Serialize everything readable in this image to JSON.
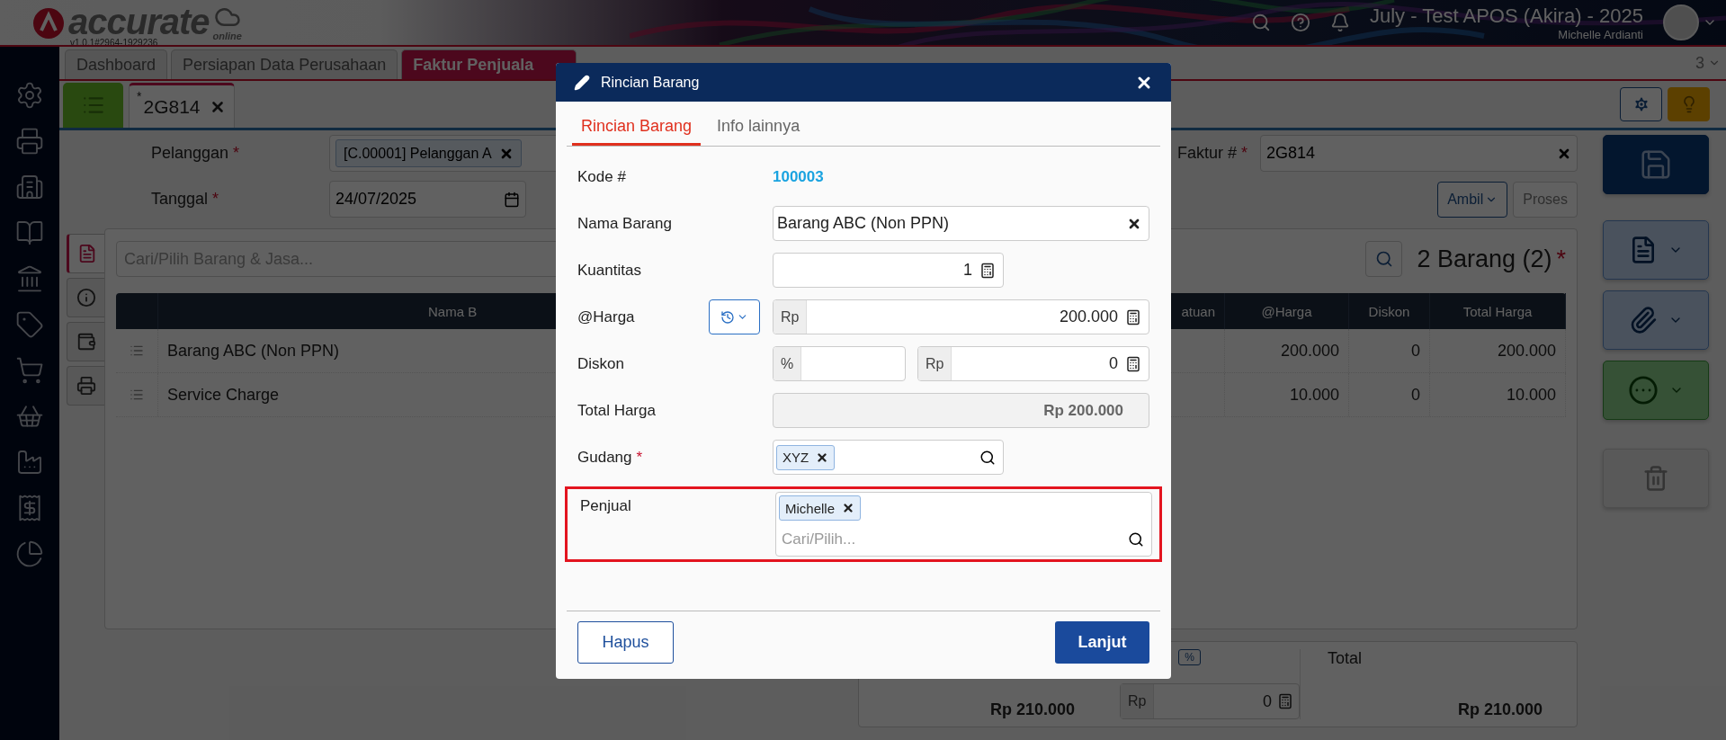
{
  "header": {
    "logo": "accurate",
    "logo_sub": "online",
    "version": "v1.0.1#2964-1929236",
    "company": "July - Test APOS (Akira) - 2025",
    "user": "Michelle Ardianti"
  },
  "page_tabs": [
    {
      "label": "Dashboard",
      "selected": false
    },
    {
      "label": "Persiapan Data Perusahaan",
      "selected": false
    },
    {
      "label": "Faktur Penjuala",
      "selected": true
    }
  ],
  "tab_count": "3",
  "doc_tab": {
    "mark": "*",
    "label": "2G814"
  },
  "form": {
    "pelanggan": {
      "label": "Pelanggan",
      "mark": "*",
      "value": "[C.00001] Pelanggan A"
    },
    "tanggal": {
      "label": "Tanggal",
      "mark": "*",
      "value": "24/07/2025"
    },
    "faktur": {
      "label": "Faktur #",
      "mark": "*",
      "value": "2G814"
    },
    "ambil": {
      "label": "Ambil",
      "disabled": false
    },
    "proses": {
      "label": "Proses",
      "disabled": true
    }
  },
  "side_tabs": [
    {
      "selected": true
    },
    {
      "selected": false
    },
    {
      "selected": false
    },
    {
      "selected": false
    }
  ],
  "items": {
    "search_placeholder": "Cari/Pilih Barang & Jasa...",
    "count": "2 Barang (2)",
    "mark": "*",
    "columns": [
      "Nama B",
      "atuan",
      "@Harga",
      "Diskon",
      "Total Harga"
    ],
    "rows": [
      {
        "name": "Barang ABC (Non PPN)",
        "harga": "200.000",
        "diskon": "0",
        "total": "200.000"
      },
      {
        "name": "Service Charge",
        "harga": "10.000",
        "diskon": "0",
        "total": "10.000"
      }
    ]
  },
  "summary": {
    "subtotal": "Rp 210.000",
    "discount_unit": "%",
    "discount_prefix": "Rp",
    "discount_value": "0",
    "total_label": "Total",
    "total": "Rp 210.000"
  },
  "dialog": {
    "title": "Rincian Barang",
    "tabs": [
      {
        "label": "Rincian Barang",
        "selected": true
      },
      {
        "label": "Info lainnya",
        "selected": false
      }
    ],
    "kode": {
      "label": "Kode #",
      "value": "100003"
    },
    "nama": {
      "label": "Nama Barang",
      "value": "Barang ABC (Non PPN)"
    },
    "kuantitas": {
      "label": "Kuantitas",
      "value": "1"
    },
    "harga": {
      "label": "@Harga",
      "prefix": "Rp",
      "value": "200.000"
    },
    "diskon": {
      "label": "Diskon",
      "percent_prefix": "%",
      "amount_prefix": "Rp",
      "amount_value": "0"
    },
    "total": {
      "label": "Total Harga",
      "value": "Rp 200.000"
    },
    "gudang": {
      "label": "Gudang",
      "mark": "*",
      "tags": [
        "XYZ"
      ]
    },
    "penjual": {
      "label": "Penjual",
      "tags": [
        "Michelle"
      ],
      "placeholder": "Cari/Pilih...",
      "highlighted": true
    },
    "buttons": {
      "delete": "Hapus",
      "next": "Lanjut"
    }
  }
}
